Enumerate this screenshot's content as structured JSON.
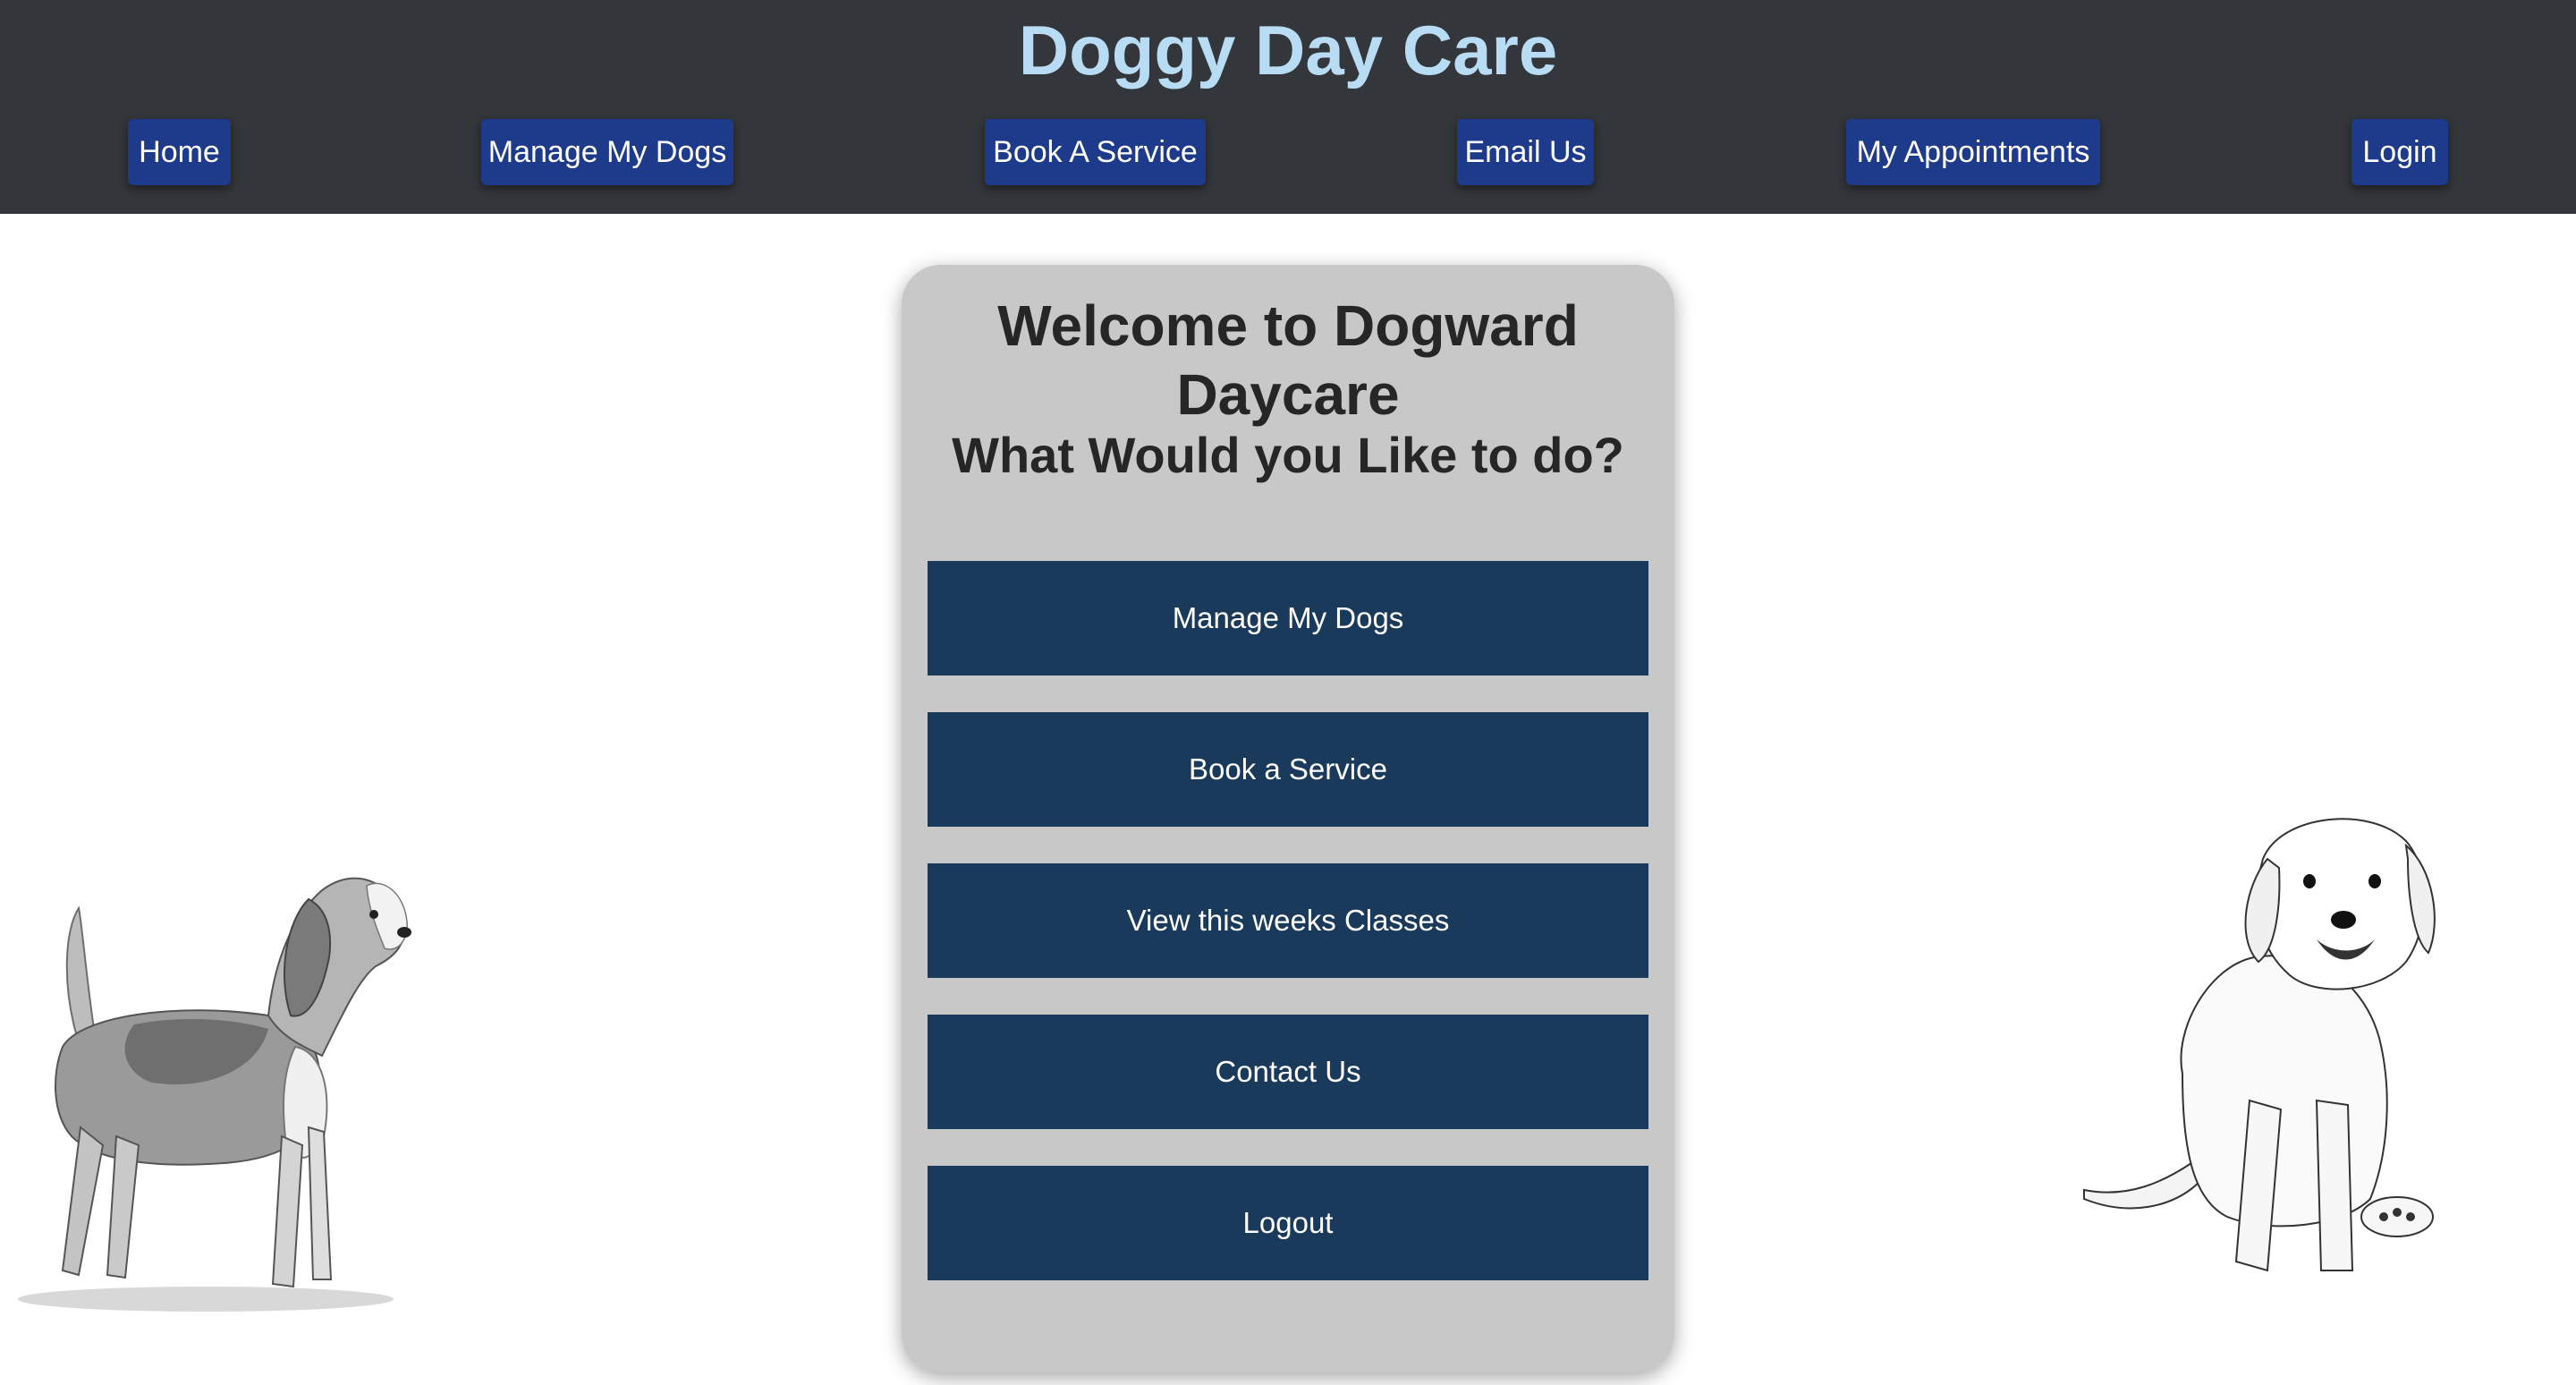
{
  "header": {
    "title": "Doggy Day Care",
    "nav": {
      "home": "Home",
      "manage_dogs": "Manage My Dogs",
      "book_service": "Book A Service",
      "email_us": "Email Us",
      "appointments": "My Appointments",
      "login": "Login"
    }
  },
  "main": {
    "welcome": "Welcome to Dogward Daycare",
    "subtitle": "What Would you Like to do?",
    "actions": [
      {
        "label": "Manage My Dogs"
      },
      {
        "label": "Book a Service"
      },
      {
        "label": "View this weeks Classes"
      },
      {
        "label": "Contact Us"
      },
      {
        "label": "Logout"
      }
    ]
  },
  "images": {
    "left": "beagle-sketch",
    "right": "puppy-sketch"
  },
  "colors": {
    "header_bg": "#33363a",
    "title_color": "#b9dcf5",
    "nav_button": "#1e3a8a",
    "card_bg": "#c8c8c8",
    "action_button": "#1a3a5c"
  }
}
